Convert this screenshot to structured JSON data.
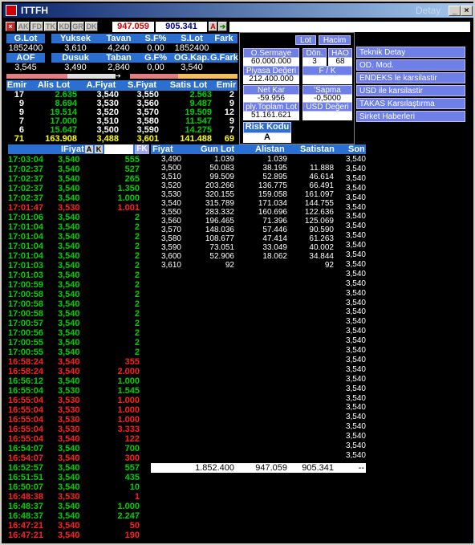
{
  "window": {
    "title": "ITTFH",
    "detay": "Detay"
  },
  "toolbar": {
    "buttons": [
      "AK",
      "FD",
      "TK",
      "KD",
      "GR",
      "DK"
    ],
    "value_red": "947.059",
    "value_blue": "905.341",
    "a_btn": "A"
  },
  "header1": {
    "labels": [
      "G.Lot",
      "Yuksek",
      "Tavan",
      "S.F%",
      "S.Lot",
      "Fark"
    ],
    "values": [
      "1852400",
      "3,610",
      "4,240",
      "0,00",
      "1852400",
      ""
    ]
  },
  "header2": {
    "labels": [
      "AOF",
      "Dusuk",
      "Taban",
      "G.F%",
      "OG.Kap.",
      "G.Fark"
    ],
    "values": [
      "3,545",
      "3,490",
      "2,840",
      "0,00",
      "3,540",
      ""
    ]
  },
  "orders": {
    "headers": [
      "Emir",
      "Alis Lot",
      "A.Fiyat",
      "S.Fiyat",
      "Satis Lot",
      "Emir"
    ],
    "rows": [
      [
        "17",
        "2.635",
        "3,540",
        "3,550",
        "2.563",
        "2"
      ],
      [
        "9",
        "8.694",
        "3,530",
        "3,560",
        "9.487",
        "9"
      ],
      [
        "9",
        "19.514",
        "3,520",
        "3,570",
        "19.509",
        "12"
      ],
      [
        "7",
        "17.000",
        "3,510",
        "3,580",
        "11.547",
        "9"
      ],
      [
        "6",
        "15.647",
        "3,500",
        "3,590",
        "14.275",
        "7"
      ],
      [
        "71",
        "163.908",
        "3,488",
        "3,601",
        "141.488",
        "69"
      ]
    ]
  },
  "mid": {
    "lot": "Lot",
    "hacim": "Hacim",
    "osermaye_lbl": "O.Sermaye",
    "osermaye_val": "60.000.000",
    "don_lbl": "Dön.",
    "don_val": "3",
    "hao_lbl": "HAO",
    "hao_val": "68",
    "piyasa_lbl": "Piyasa Değeri",
    "piyasa_val": "212.400.000",
    "fk_lbl": "F / K",
    "fk_val": "",
    "netkar_lbl": "Net Kar",
    "netkar_val": "-59.956",
    "sapma_lbl": "'Sapma",
    "sapma_val": "-0,5000",
    "toplot_lbl": "ply.Toplam Lot",
    "toplot_val": "51.161.621",
    "usd_lbl": "USD Değeri",
    "usd_val": "",
    "risk_lbl": "Risk Kodu",
    "risk_val": "A"
  },
  "menu": [
    "Teknik Detay",
    "OD. Mod.",
    "ENDEKS le karsilastir",
    "USD ile karsilastir",
    "TAKAS Karsılaştırma",
    "Sirket Haberleri"
  ],
  "trades": {
    "headers": {
      "fiyat": "IFiyat",
      "a": "A",
      "k": "K",
      "fk": "FK"
    },
    "rows": [
      [
        "17:03:04",
        "3,540",
        "555",
        "g"
      ],
      [
        "17:02:37",
        "3,540",
        "527",
        "g"
      ],
      [
        "17:02:37",
        "3,540",
        "265",
        "g"
      ],
      [
        "17:02:37",
        "3,540",
        "1.350",
        "g"
      ],
      [
        "17:02:37",
        "3,540",
        "1.000",
        "g"
      ],
      [
        "17:01:47",
        "3,530",
        "1.001",
        "r"
      ],
      [
        "17:01:06",
        "3,540",
        "2",
        "g"
      ],
      [
        "17:01:04",
        "3,540",
        "2",
        "g"
      ],
      [
        "17:01:04",
        "3,540",
        "2",
        "g"
      ],
      [
        "17:01:04",
        "3,540",
        "2",
        "g"
      ],
      [
        "17:01:04",
        "3,540",
        "2",
        "g"
      ],
      [
        "17:01:03",
        "3,540",
        "2",
        "g"
      ],
      [
        "17:01:03",
        "3,540",
        "2",
        "g"
      ],
      [
        "17:00:59",
        "3,540",
        "2",
        "g"
      ],
      [
        "17:00:58",
        "3,540",
        "2",
        "g"
      ],
      [
        "17:00:58",
        "3,540",
        "2",
        "g"
      ],
      [
        "17:00:58",
        "3,540",
        "2",
        "g"
      ],
      [
        "17:00:57",
        "3,540",
        "2",
        "g"
      ],
      [
        "17:00:56",
        "3,540",
        "2",
        "g"
      ],
      [
        "17:00:55",
        "3,540",
        "2",
        "g"
      ],
      [
        "17:00:55",
        "3,540",
        "2",
        "g"
      ],
      [
        "16:58:24",
        "3,540",
        "355",
        "r"
      ],
      [
        "16:58:24",
        "3,540",
        "2.000",
        "r"
      ],
      [
        "16:56:12",
        "3,540",
        "1.000",
        "g"
      ],
      [
        "16:55:04",
        "3,530",
        "1.545",
        "g"
      ],
      [
        "16:55:04",
        "3,530",
        "1.000",
        "r"
      ],
      [
        "16:55:04",
        "3,530",
        "1.000",
        "r"
      ],
      [
        "16:55:04",
        "3,530",
        "1.000",
        "r"
      ],
      [
        "16:55:04",
        "3,530",
        "3.333",
        "r"
      ],
      [
        "16:55:04",
        "3,540",
        "122",
        "r"
      ],
      [
        "16:54:07",
        "3,540",
        "700",
        "g"
      ],
      [
        "16:54:07",
        "3,540",
        "300",
        "r"
      ],
      [
        "16:52:57",
        "3,540",
        "557",
        "g"
      ],
      [
        "16:51:51",
        "3,540",
        "435",
        "g"
      ],
      [
        "16:50:07",
        "3,540",
        "10",
        "g"
      ],
      [
        "16:48:38",
        "3,530",
        "1",
        "r"
      ],
      [
        "16:48:37",
        "3,540",
        "1.000",
        "g"
      ],
      [
        "16:48:37",
        "3,540",
        "2.247",
        "g"
      ],
      [
        "16:47:21",
        "3,540",
        "50",
        "r"
      ],
      [
        "16:47:21",
        "3,540",
        "190",
        "r"
      ]
    ]
  },
  "dist": {
    "headers": [
      "Fiyat",
      "Gun Lot",
      "Alistan",
      "Satistan",
      "Son"
    ],
    "rows": [
      [
        "3,490",
        "1.039",
        "1.039",
        ""
      ],
      [
        "3,500",
        "50.083",
        "38.195",
        "11.888"
      ],
      [
        "3,510",
        "99.509",
        "52.895",
        "46.614"
      ],
      [
        "3,520",
        "203.266",
        "136.775",
        "66.491"
      ],
      [
        "3,530",
        "320.155",
        "159.058",
        "161.097"
      ],
      [
        "3,540",
        "315.789",
        "171.034",
        "144.755"
      ],
      [
        "3,550",
        "283.332",
        "160.696",
        "122.636"
      ],
      [
        "3,560",
        "196.465",
        "71.396",
        "125.069"
      ],
      [
        "3,570",
        "148.036",
        "57.446",
        "90.590"
      ],
      [
        "3,580",
        "108.677",
        "47.414",
        "61.263"
      ],
      [
        "3,590",
        "73.051",
        "33.049",
        "40.002"
      ],
      [
        "3,600",
        "52.906",
        "18.062",
        "34.844"
      ],
      [
        "3,610",
        "92",
        "",
        "92"
      ]
    ],
    "son_value": "3,540",
    "total": [
      "1.852.400",
      "947.059",
      "905.341",
      "--"
    ]
  }
}
